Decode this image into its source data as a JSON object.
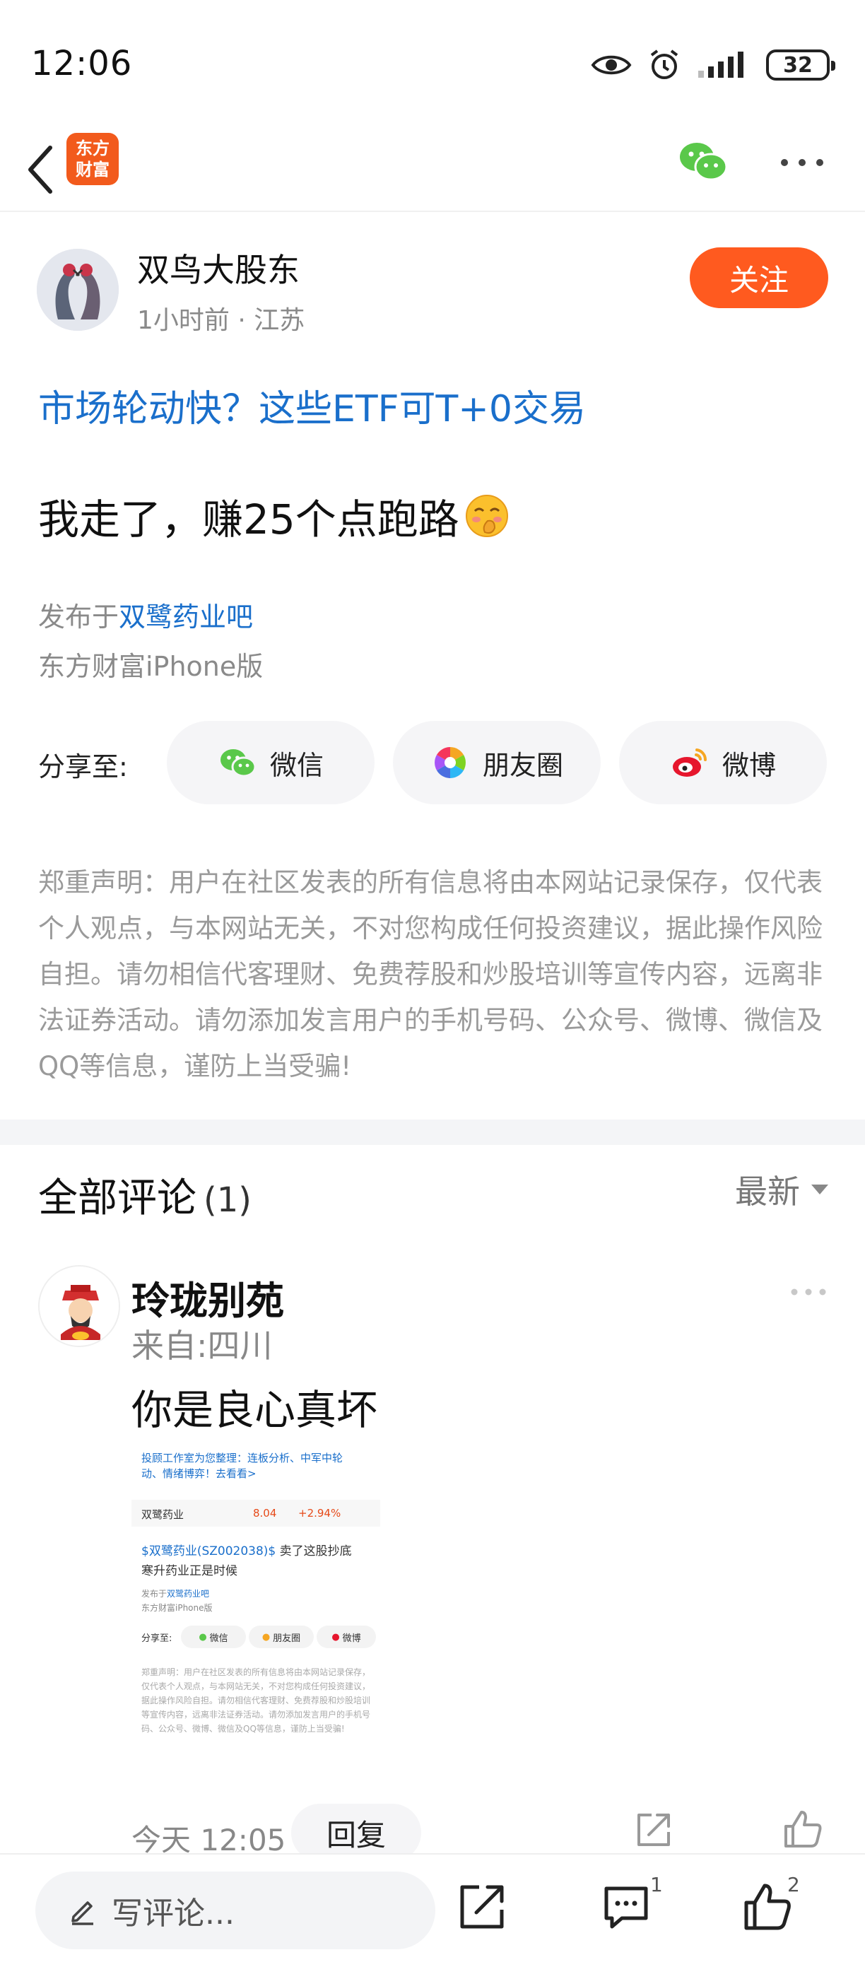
{
  "status_bar": {
    "time": "12:06",
    "battery": "32"
  },
  "nav": {
    "logo_line1": "东方",
    "logo_line2": "财富"
  },
  "author": {
    "name": "双鸟大股东",
    "meta": "1小时前 · 江苏",
    "follow_label": "关注"
  },
  "post": {
    "link_title": "市场轮动快？这些ETF可T+0交易",
    "body": "我走了，赚25个点跑路",
    "published_prefix": "发布于",
    "forum": "双鹭药业吧",
    "client": "东方财富iPhone版"
  },
  "share": {
    "label": "分享至:",
    "wechat": "微信",
    "moments": "朋友圈",
    "weibo": "微博"
  },
  "disclaimer": "郑重声明：用户在社区发表的所有信息将由本网站记录保存，仅代表个人观点，与本网站无关，不对您构成任何投资建议，据此操作风险自担。请勿相信代客理财、免费荐股和炒股培训等宣传内容，远离非法证券活动。请勿添加发言用户的手机号码、公众号、微博、微信及QQ等信息，谨防上当受骗!",
  "comments": {
    "title": "全部评论",
    "count": "(1)",
    "sort_label": "最新",
    "item": {
      "name": "玲珑别苑",
      "location": "来自:四川",
      "text": "你是良心真坏",
      "time": "今天 12:05",
      "reply_label": "回复",
      "image": {
        "line1": "投顾工作室为您整理：连板分析、中军中轮",
        "line2": "动、情绪博弈！去看看>",
        "stock_name": "双鹭药业",
        "stock_price": "8.04",
        "stock_change": "+2.94%",
        "post_stock": "$双鹭药业(SZ002038)$",
        "post_text1": "卖了这股抄底",
        "post_text2": "寒升药业正是时候",
        "pub_prefix": "发布于",
        "pub_forum": "双鹭药业吧",
        "client": "东方财富iPhone版",
        "share_label": "分享至:",
        "share_wechat": "微信",
        "share_moments": "朋友圈",
        "share_weibo": "微博",
        "disclaimer": "郑重声明：用户在社区发表的所有信息将由本网站记录保存，仅代表个人观点，与本网站无关，不对您构成任何投资建议，据此操作风险自担。请勿相信代客理财、免费荐股和炒股培训等宣传内容，远离非法证券活动。请勿添加发言用户的手机号码、公众号、微博、微信及QQ等信息，谨防上当受骗!"
      }
    }
  },
  "bottom_bar": {
    "input_placeholder": "写评论...",
    "comment_count": "1",
    "like_count": "2"
  },
  "colors": {
    "accent": "#ff5a1f",
    "link": "#1a6fcb",
    "wechat_green": "#5ac84a"
  }
}
